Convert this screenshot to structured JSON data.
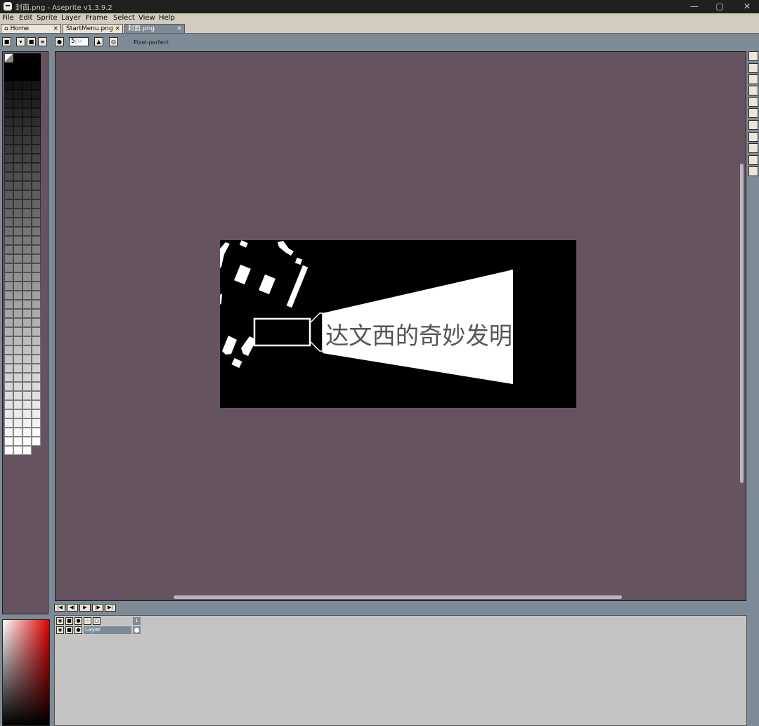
{
  "window": {
    "title": "封面.png - Aseprite v1.3.9.2",
    "controls": [
      "—",
      "▢",
      "✕"
    ]
  },
  "menubar": [
    "File",
    "Edit",
    "Sprite",
    "Layer",
    "Frame",
    "Select",
    "View",
    "Help"
  ],
  "tabs": [
    {
      "label": "Home",
      "close": "×"
    },
    {
      "label": "StartMenu.png",
      "close": "×"
    },
    {
      "label": "封面.png",
      "close": "×"
    }
  ],
  "context_bar": {
    "brush_size": "5",
    "brush_unit": "px",
    "pixel_perfect_label": "Pixel-perfect"
  },
  "artwork": {
    "text": "达文西的奇妙发明"
  },
  "timeline": {
    "frame_number": "1",
    "layer_name": "Layer"
  },
  "colors": {
    "workspace_bg": "#65545f",
    "chrome": "#7d8b96",
    "menu_bg": "#d2cbbe",
    "button_face": "#ece5d8"
  }
}
